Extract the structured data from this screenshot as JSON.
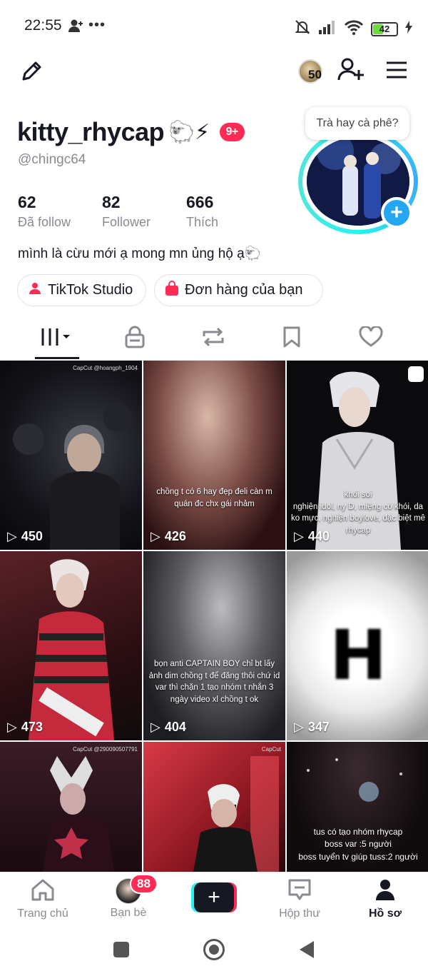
{
  "status_bar": {
    "time": "22:55",
    "dots": "•••",
    "battery": "42"
  },
  "header": {
    "coins": "50",
    "icons": [
      "edit-pencil-icon",
      "coin-avatar-icon",
      "add-friend-icon",
      "menu-icon"
    ]
  },
  "profile": {
    "display_name": "kitty_rhycap",
    "emoji": "🐑⚡",
    "notification_badge": "9+",
    "handle": "@chingc64",
    "stats": [
      {
        "value": "62",
        "label": "Đã follow"
      },
      {
        "value": "82",
        "label": "Follower"
      },
      {
        "value": "666",
        "label": "Thích"
      }
    ],
    "bio": "mình là cừu mới ạ mong mn ủng hộ ạ🐑",
    "buttons": [
      {
        "label": "TikTok Studio",
        "icon": "studio-icon"
      },
      {
        "label": "Đơn hàng của bạn",
        "icon": "shopping-bag-icon"
      }
    ],
    "status_bubble": "Trà hay cà phê?"
  },
  "tabs": [
    "videos-grid-tab",
    "private-lock-tab",
    "reposts-tab",
    "bookmarks-tab",
    "liked-tab"
  ],
  "videos": [
    {
      "views": "450",
      "caption": "",
      "watermark": "CapCut @hoangph_1904"
    },
    {
      "views": "426",
      "caption": "chồng t có 6 hay đẹp đeli càn m quán đc chx gái nhảm",
      "watermark": ""
    },
    {
      "views": "440",
      "caption": "khói soi\nnghiện idol, ny D, miệng có khói, da ko mực, nghiện boylove, đặc biệt mê rhycap",
      "watermark": ""
    },
    {
      "views": "473",
      "caption": "",
      "watermark": ""
    },
    {
      "views": "404",
      "caption": "bọn anti CAPTAIN BOY chỉ bt lấy ảnh dim chồng t để đăng thôi chứ id var thì chặn 1 tạo nhóm t nhắn 3 ngày video xl chồng t ok",
      "watermark": ""
    },
    {
      "views": "347",
      "caption": "H",
      "watermark": ""
    },
    {
      "views": "",
      "caption": "",
      "watermark": "CapCut @290090507791"
    },
    {
      "views": "",
      "caption": "",
      "watermark": "CapCut"
    },
    {
      "views": "",
      "caption": "tus có tạo nhóm rhycap\nboss var :5 người\nboss tuyển tv giúp tuss:2 người",
      "watermark": ""
    }
  ],
  "bottom_nav": [
    {
      "label": "Trang chủ",
      "icon": "home-icon"
    },
    {
      "label": "Bạn bè",
      "icon": "friends-avatar",
      "badge": "88"
    },
    {
      "label": "",
      "icon": "create-plus-icon"
    },
    {
      "label": "Hộp thư",
      "icon": "inbox-icon"
    },
    {
      "label": "Hồ sơ",
      "icon": "profile-icon"
    }
  ],
  "colors": {
    "accent": "#fe2c55",
    "cyan": "#25f4ee",
    "text": "#161823",
    "muted": "#8a8b91"
  }
}
